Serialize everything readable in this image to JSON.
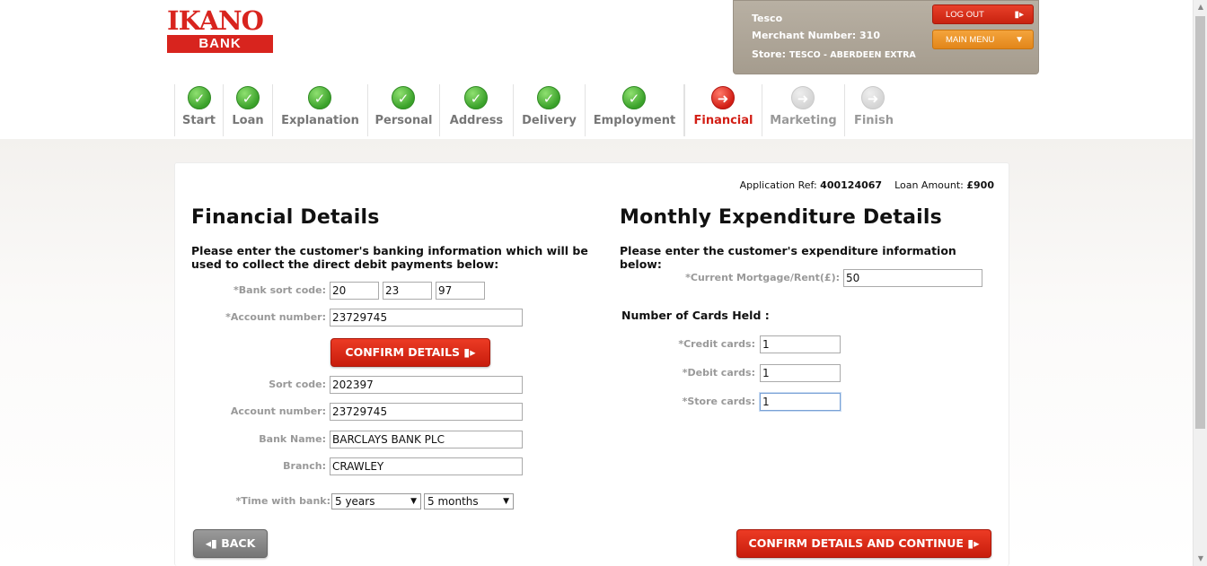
{
  "logo": {
    "top": "IKANO",
    "bottom": "BANK"
  },
  "merchant": {
    "name": "Tesco",
    "number_label": "Merchant Number:",
    "number": "310",
    "store_label": "Store:",
    "store": "TESCO - ABERDEEN EXTRA",
    "logout_label": "LOG OUT",
    "main_menu_label": "MAIN MENU"
  },
  "steps": [
    {
      "label": "Start",
      "status": "done"
    },
    {
      "label": "Loan",
      "status": "done"
    },
    {
      "label": "Explanation",
      "status": "done"
    },
    {
      "label": "Personal",
      "status": "done"
    },
    {
      "label": "Address",
      "status": "done"
    },
    {
      "label": "Delivery",
      "status": "done"
    },
    {
      "label": "Employment",
      "status": "done"
    },
    {
      "label": "Financial",
      "status": "current"
    },
    {
      "label": "Marketing",
      "status": "todo"
    },
    {
      "label": "Finish",
      "status": "todo"
    }
  ],
  "application": {
    "ref_label": "Application Ref:",
    "ref": "400124067",
    "amount_label": "Loan Amount:",
    "amount": "£900"
  },
  "financial": {
    "title": "Financial Details",
    "intro": "Please enter the customer's banking information which will be used to collect the direct debit payments below:",
    "sort_code_label": "*Bank sort code:",
    "sort_code_1": "20",
    "sort_code_2": "23",
    "sort_code_3": "97",
    "account_label": "*Account number:",
    "account": "23729745",
    "confirm_label": "CONFIRM DETAILS",
    "result_sort_label": "Sort code:",
    "result_sort": "202397",
    "result_account_label": "Account number:",
    "result_account": "23729745",
    "bank_name_label": "Bank Name:",
    "bank_name": "BARCLAYS BANK PLC",
    "branch_label": "Branch:",
    "branch": "CRAWLEY",
    "time_label": "*Time with bank:",
    "time_years": "5 years",
    "time_months": "5 months"
  },
  "expenditure": {
    "title": "Monthly Expenditure Details",
    "intro": "Please enter the customer's expenditure information below:",
    "mortgage_label": "*Current Mortgage/Rent(£):",
    "mortgage": "50",
    "cards_heading": "Number of Cards Held :",
    "credit_label": "*Credit cards:",
    "credit": "1",
    "debit_label": "*Debit cards:",
    "debit": "1",
    "store_label": "*Store cards:",
    "store": "1"
  },
  "footer": {
    "back_label": "BACK",
    "continue_label": "CONFIRM DETAILS AND CONTINUE"
  },
  "colors": {
    "brand_red": "#d8241e",
    "done_green": "#3aa12a",
    "current_red": "#d21e15",
    "panel_taupe": "#ada496"
  }
}
